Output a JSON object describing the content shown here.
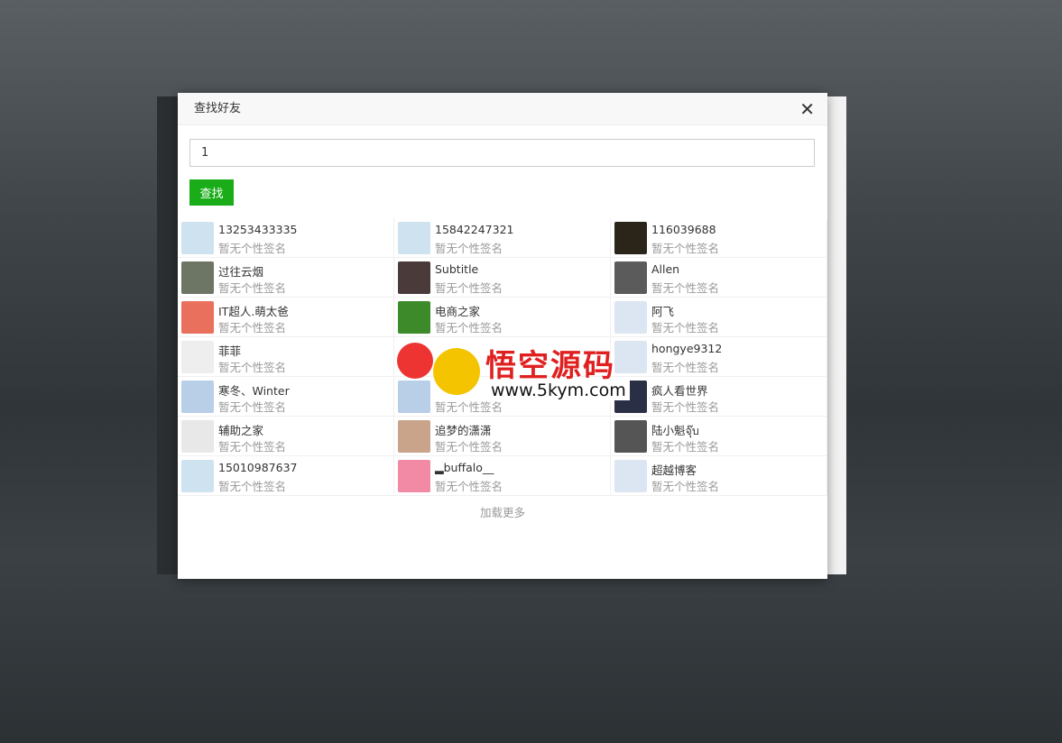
{
  "dialog": {
    "title": "查找好友",
    "close_icon": "close-icon"
  },
  "search": {
    "value": "1",
    "button": "查找"
  },
  "colors": {
    "accent": "#1aad19"
  },
  "results": [
    {
      "name": "13253433335",
      "sign": "暂无个性签名",
      "avatar": "#cfe2f0"
    },
    {
      "name": "15842247321",
      "sign": "暂无个性签名",
      "avatar": "#cfe2f0"
    },
    {
      "name": "116039688",
      "sign": "暂无个性签名",
      "avatar": "#2b2418"
    },
    {
      "name": "过往云烟",
      "sign": "暂无个性签名",
      "avatar": "#6d7564"
    },
    {
      "name": "Subtitle",
      "sign": "暂无个性签名",
      "avatar": "#4a3a3a"
    },
    {
      "name": "Allen",
      "sign": "暂无个性签名",
      "avatar": "#5b5b5b"
    },
    {
      "name": "IT超人.萌太爸",
      "sign": "暂无个性签名",
      "avatar": "#e9705d"
    },
    {
      "name": "电商之家",
      "sign": "暂无个性签名",
      "avatar": "#3d8a2a"
    },
    {
      "name": "阿飞",
      "sign": "暂无个性签名",
      "avatar": "#dbe6f2"
    },
    {
      "name": "菲菲",
      "sign": "暂无个性签名",
      "avatar": "#eeeeee"
    },
    {
      "name": "",
      "sign": "",
      "avatar": "#ffffff"
    },
    {
      "name": "hongye9312",
      "sign": "暂无个性签名",
      "avatar": "#dbe6f2"
    },
    {
      "name": "寒冬、Winter",
      "sign": "暂无个性签名",
      "avatar": "#b9cfe8"
    },
    {
      "name": "",
      "sign": "暂无个性签名",
      "avatar": "#b9cfe8"
    },
    {
      "name": "疯人看世界",
      "sign": "暂无个性签名",
      "avatar": "#2a2f45"
    },
    {
      "name": "辅助之家",
      "sign": "暂无个性签名",
      "avatar": "#e8e8e8"
    },
    {
      "name": "追梦的潇潇",
      "sign": "暂无个性签名",
      "avatar": "#c9a48a"
    },
    {
      "name": "陆小魁จุ๊บ",
      "sign": "暂无个性签名",
      "avatar": "#555555"
    },
    {
      "name": "15010987637",
      "sign": "暂无个性签名",
      "avatar": "#cfe2f0"
    },
    {
      "name": "▂buffalo__",
      "sign": "暂无个性签名",
      "avatar": "#f28aa6"
    },
    {
      "name": "超越博客",
      "sign": "暂无个性签名",
      "avatar": "#dbe6f2"
    }
  ],
  "load_more": "加载更多",
  "watermark": {
    "title": "悟空源码",
    "url": "www.5kym.com"
  }
}
